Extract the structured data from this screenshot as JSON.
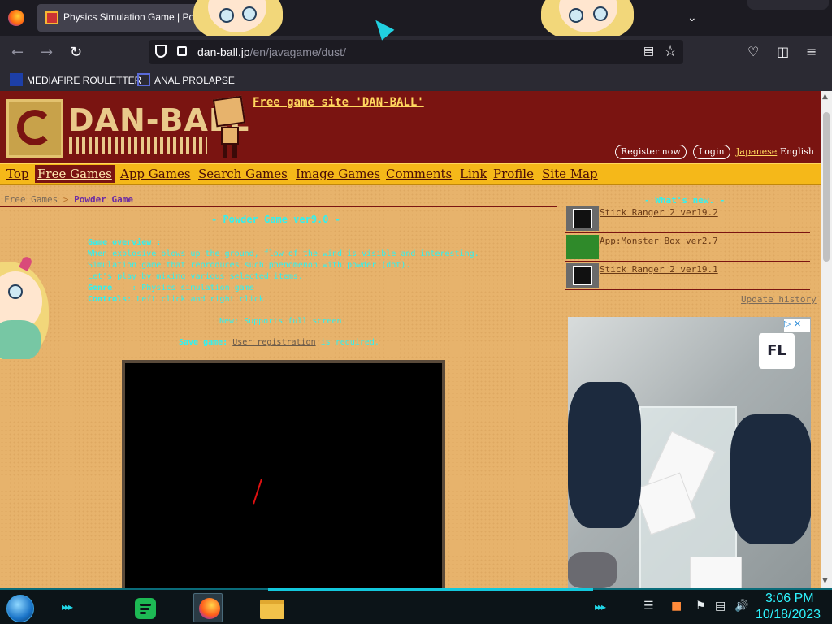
{
  "browser": {
    "tab_title": "Physics Simulation Game | Po",
    "url_domain": "dan-ball.jp",
    "url_path": "/en/javagame/dust/",
    "bookmarks": [
      "MEDIAFIRE ROULETTER",
      "ANAL PROLAPSE"
    ]
  },
  "site": {
    "logo": "DAN-BALL",
    "tagline": "Free game site 'DAN-BALL'",
    "register": "Register now",
    "login": "Login",
    "lang_japanese": "Japanese",
    "lang_english": "English",
    "nav": [
      "Top",
      "Free Games",
      "App Games",
      "Search Games",
      "Image Games",
      "Comments",
      "Link",
      "Profile",
      "Site Map"
    ],
    "active_nav": "Free Games"
  },
  "breadcrumb": {
    "parent": "Free Games",
    "separator": ">",
    "current": "Powder Game"
  },
  "game": {
    "title": "- Powder Game ver9.0 -",
    "overview_heading": "Game overview :",
    "overview_lines": [
      "When explosive blows up the ground, flow of the wind is visible and interesting.",
      "Simulation game that reproduces such phenomenon with powder (dot).",
      "Let's play by mixing various selected items."
    ],
    "genre_label": "Genre",
    "genre_value": ": Physics simulation game",
    "controls_label": "Controls",
    "controls_value": ": Left click and right click",
    "fullscreen_note": "New: Supports full screen.",
    "save_label": "Save game:",
    "save_link": "User registration",
    "save_suffix": "is required."
  },
  "sidebar": {
    "whats_new": "- What's new. -",
    "news": [
      "Stick Ranger 2 ver19.2",
      "App:Monster Box ver2.7",
      "Stick Ranger 2 ver19.1"
    ],
    "update_history": "Update history"
  },
  "ad": {
    "logo": "FL"
  },
  "taskbar": {
    "time": "3:06 PM",
    "date": "10/18/2023"
  },
  "colors": {
    "page_bg": "#e7b36c",
    "header_bg": "#7a1411",
    "nav_bg": "#f5b819",
    "game_text": "#2ef2f2",
    "clock": "#2ff5ff"
  }
}
